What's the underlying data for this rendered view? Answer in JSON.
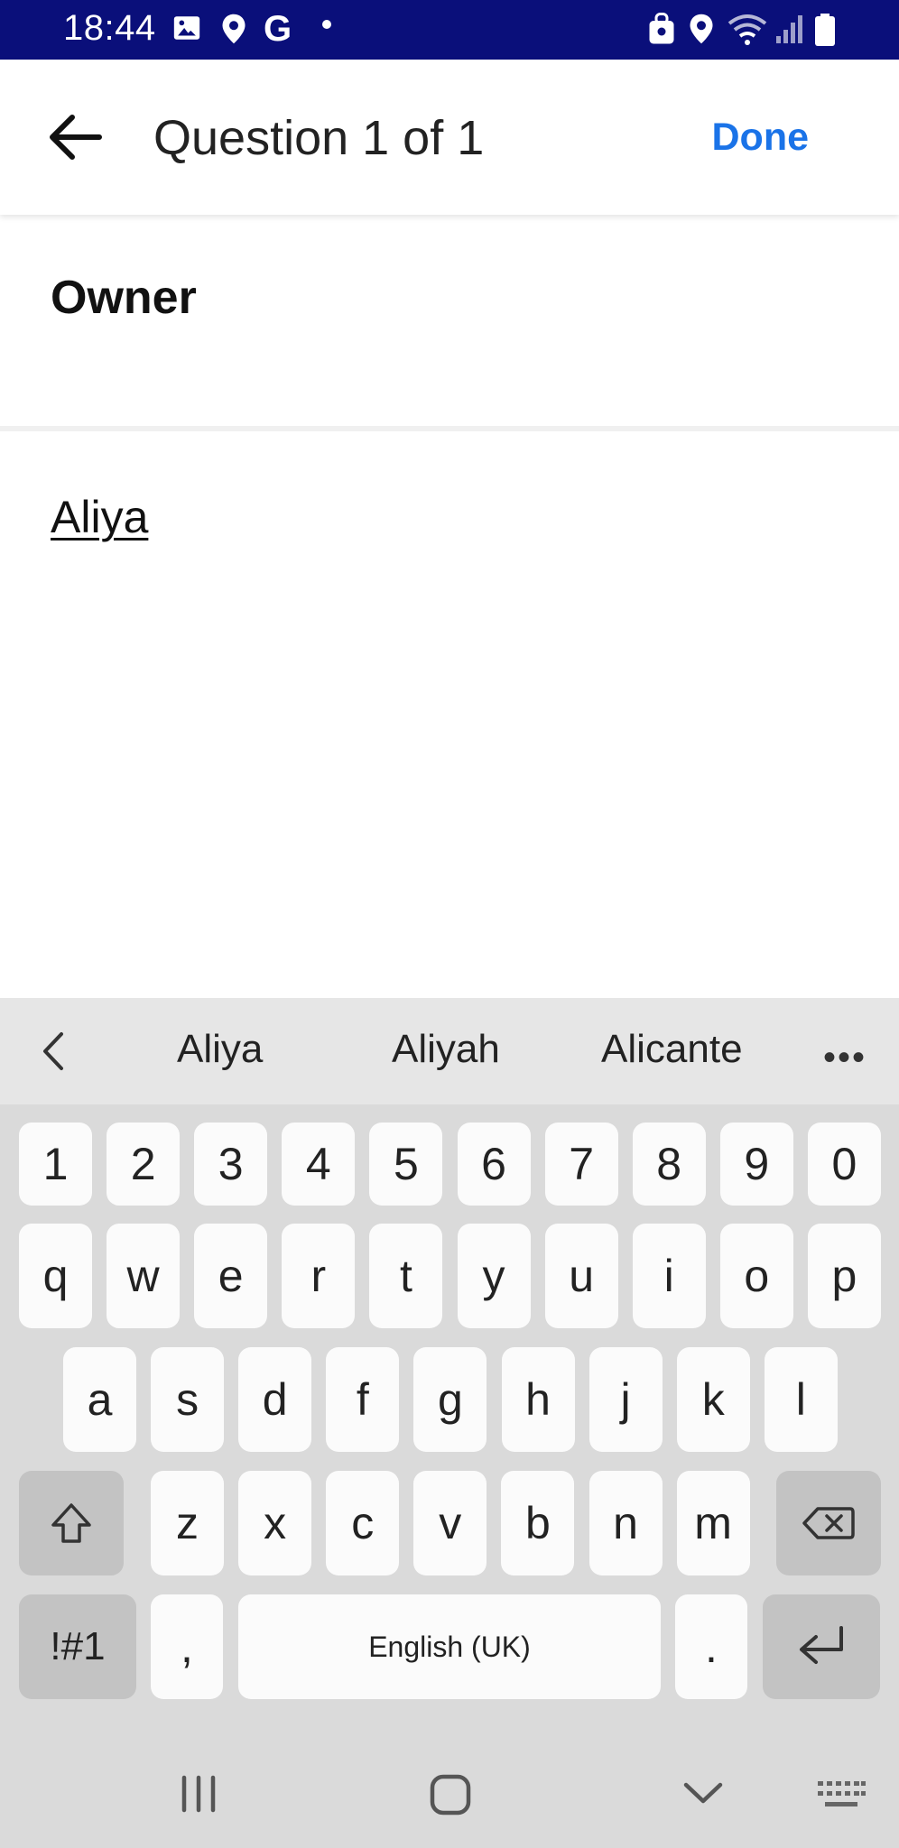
{
  "status_bar": {
    "time": "18:44",
    "left_icons": [
      "image-icon",
      "location-icon",
      "google-icon",
      "dot-icon"
    ],
    "right_icons": [
      "secure-icon",
      "location-icon",
      "wifi-icon",
      "signal-icon",
      "battery-icon"
    ],
    "bg_color": "#0a0f7a"
  },
  "app_bar": {
    "title": "Question 1 of 1",
    "done_label": "Done",
    "accent_color": "#1a73e8"
  },
  "question": {
    "label": "Owner"
  },
  "answer": {
    "value": "Aliya"
  },
  "keyboard": {
    "suggestions": [
      "Aliya",
      "Aliyah",
      "Alicante"
    ],
    "more_label": "•••",
    "number_row": [
      "1",
      "2",
      "3",
      "4",
      "5",
      "6",
      "7",
      "8",
      "9",
      "0"
    ],
    "row1": [
      "q",
      "w",
      "e",
      "r",
      "t",
      "y",
      "u",
      "i",
      "o",
      "p"
    ],
    "row2": [
      "a",
      "s",
      "d",
      "f",
      "g",
      "h",
      "j",
      "k",
      "l"
    ],
    "row3": [
      "z",
      "x",
      "c",
      "v",
      "b",
      "n",
      "m"
    ],
    "symbols_label": "!#1",
    "comma_label": ",",
    "space_label": "English (UK)",
    "period_label": "."
  }
}
